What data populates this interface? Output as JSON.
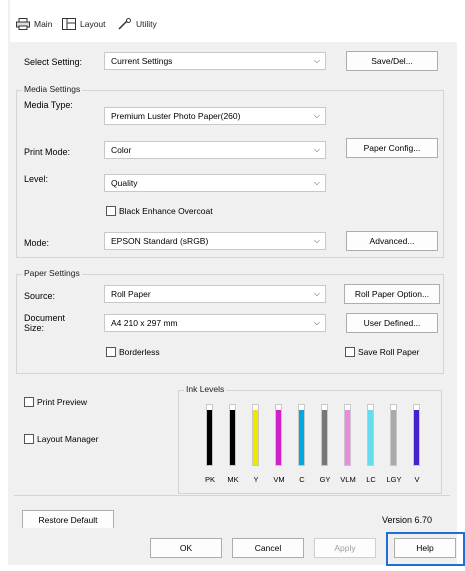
{
  "tabs": [
    {
      "label": "Main",
      "icon": "printer-icon"
    },
    {
      "label": "Layout",
      "icon": "layout-icon"
    },
    {
      "label": "Utility",
      "icon": "wrench-icon"
    }
  ],
  "select_setting": {
    "label": "Select Setting:",
    "value": "Current Settings",
    "button": "Save/Del..."
  },
  "media_settings": {
    "title": "Media Settings",
    "media_type_label": "Media Type:",
    "media_type_value": "Premium Luster Photo Paper(260)",
    "print_mode_label": "Print Mode:",
    "print_mode_value": "Color",
    "paper_config_button": "Paper Config...",
    "level_label": "Level:",
    "level_value": "Quality",
    "black_enhance_label": "Black Enhance Overcoat",
    "mode_label": "Mode:",
    "mode_value": "EPSON Standard (sRGB)",
    "advanced_button": "Advanced..."
  },
  "paper_settings": {
    "title": "Paper Settings",
    "source_label": "Source:",
    "source_value": "Roll Paper",
    "roll_option_button": "Roll Paper Option...",
    "doc_size_label_1": "Document",
    "doc_size_label_2": "Size:",
    "doc_size_value": "A4 210 x 297 mm",
    "user_defined_button": "User Defined...",
    "borderless_label": "Borderless",
    "save_roll_label": "Save Roll Paper"
  },
  "print_preview_label": "Print Preview",
  "layout_manager_label": "Layout Manager",
  "ink_levels": {
    "title": "Ink Levels",
    "inks": [
      {
        "code": "PK",
        "color": "#000000",
        "level": 0.92
      },
      {
        "code": "MK",
        "color": "#000000",
        "level": 0.92
      },
      {
        "code": "Y",
        "color": "#f2e600",
        "level": 0.92
      },
      {
        "code": "VM",
        "color": "#d020c8",
        "level": 0.92
      },
      {
        "code": "C",
        "color": "#00a8e0",
        "level": 0.92
      },
      {
        "code": "GY",
        "color": "#777777",
        "level": 0.92
      },
      {
        "code": "VLM",
        "color": "#ee88dd",
        "level": 0.92
      },
      {
        "code": "LC",
        "color": "#66ddee",
        "level": 0.92
      },
      {
        "code": "LGY",
        "color": "#aaaaaa",
        "level": 0.92
      },
      {
        "code": "V",
        "color": "#4422cc",
        "level": 0.92
      }
    ]
  },
  "restore_default_button": "Restore Default",
  "version_text": "Version 6.70",
  "dialog_buttons": {
    "ok": "OK",
    "cancel": "Cancel",
    "apply": "Apply",
    "help": "Help"
  },
  "highlight_color": "#1e6fd9"
}
